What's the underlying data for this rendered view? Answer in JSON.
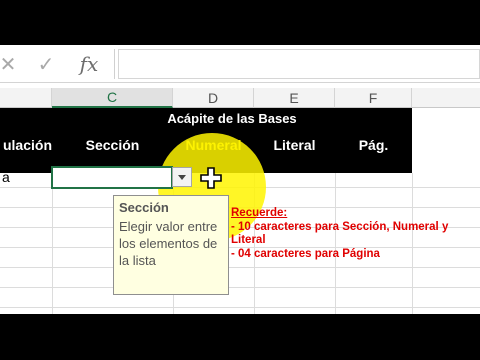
{
  "formula_bar": {
    "cancel_icon": "✕",
    "enter_icon": "✓",
    "fx_label": "fx",
    "value": ""
  },
  "columns": [
    "C",
    "D",
    "E",
    "F"
  ],
  "banner": {
    "title": "Acápite de las Bases",
    "headers": [
      "ulación",
      "Sección",
      "Numeral",
      "Literal",
      "Pág."
    ],
    "highlight_color": "#f0e000"
  },
  "cells": {
    "b_row1": "a"
  },
  "tooltip": {
    "title": "Sección",
    "body": "Elegir valor entre los elementos de la lista"
  },
  "note": {
    "title": "Recuerde:",
    "line1": "- 10 caracteres para Sección, Numeral y Literal",
    "line2": "- 04 caracteres para Página",
    "color": "#e00000"
  },
  "icons": {
    "cursor": "plus-cursor-icon",
    "dropdown": "dropdown-arrow-icon"
  }
}
